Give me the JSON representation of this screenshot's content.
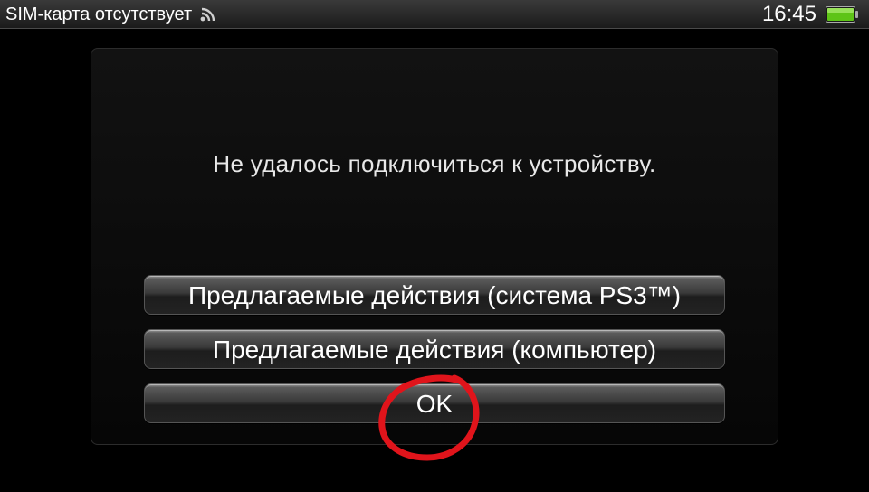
{
  "status_bar": {
    "carrier_text": "SIM-карта отсутствует",
    "wifi_icon": "wifi-signal-icon",
    "time": "16:45",
    "battery_icon": "battery-full-icon",
    "battery_color": "#5ec416"
  },
  "dialog": {
    "message": "Не удалось подключиться к устройству.",
    "buttons": [
      {
        "label": "Предлагаемые действия (система PS3™)"
      },
      {
        "label": "Предлагаемые действия (компьютер)"
      },
      {
        "label": "OK"
      }
    ]
  },
  "annotation": {
    "shape": "hand-drawn-circle",
    "color": "#e0141b"
  }
}
